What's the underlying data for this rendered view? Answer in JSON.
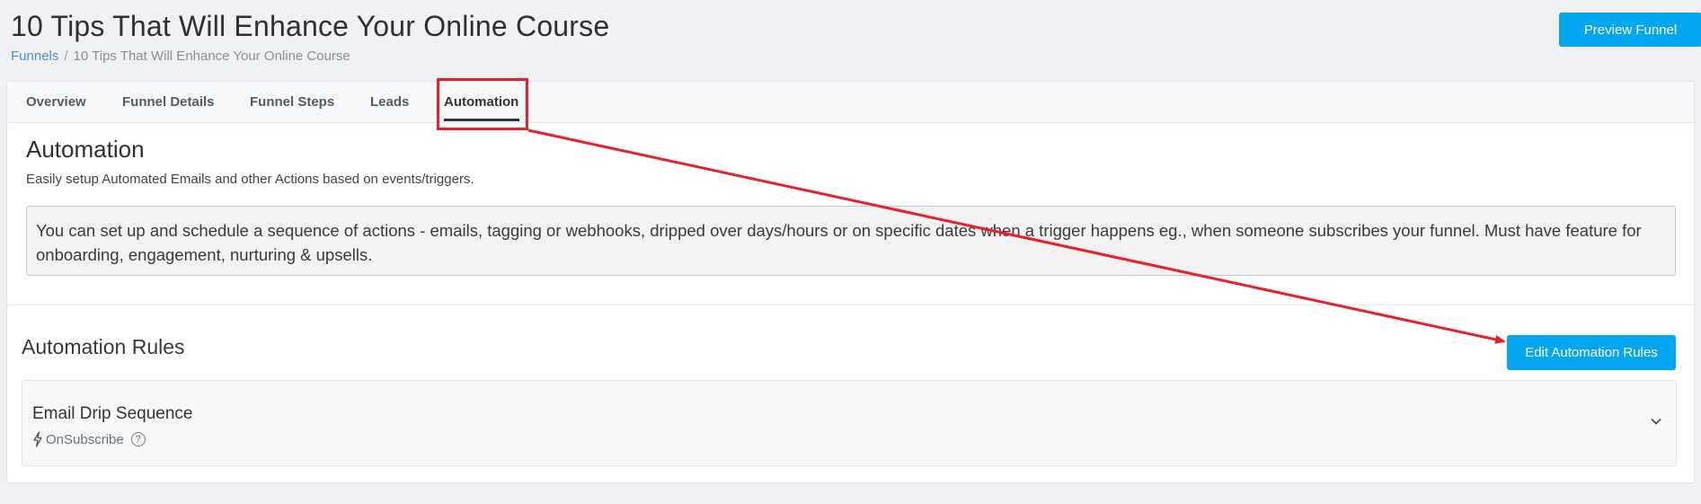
{
  "page": {
    "title": "10 Tips That Will Enhance Your Online Course",
    "preview_button": "Preview Funnel"
  },
  "breadcrumb": {
    "root": "Funnels",
    "separator": "/",
    "current": "10 Tips That Will Enhance Your Online Course"
  },
  "tabs": [
    {
      "label": "Overview"
    },
    {
      "label": "Funnel Details"
    },
    {
      "label": "Funnel Steps"
    },
    {
      "label": "Leads"
    },
    {
      "label": "Automation",
      "active": true
    }
  ],
  "automation": {
    "title": "Automation",
    "subtitle": "Easily setup Automated Emails and other Actions based on events/triggers.",
    "info": "You can set up and schedule a sequence of actions - emails, tagging or webhooks, dripped over days/hours or on specific dates when a trigger happens eg., when someone subscribes your funnel. Must have feature for onboarding, engagement, nurturing & upsells."
  },
  "rules": {
    "title": "Automation Rules",
    "edit_button": "Edit Automation Rules",
    "items": [
      {
        "name": "Email Drip Sequence",
        "trigger": "OnSubscribe",
        "help": "?"
      }
    ]
  },
  "colors": {
    "accent": "#05a6f0",
    "annotation": "#e8202a",
    "link": "#4f8cc9"
  }
}
